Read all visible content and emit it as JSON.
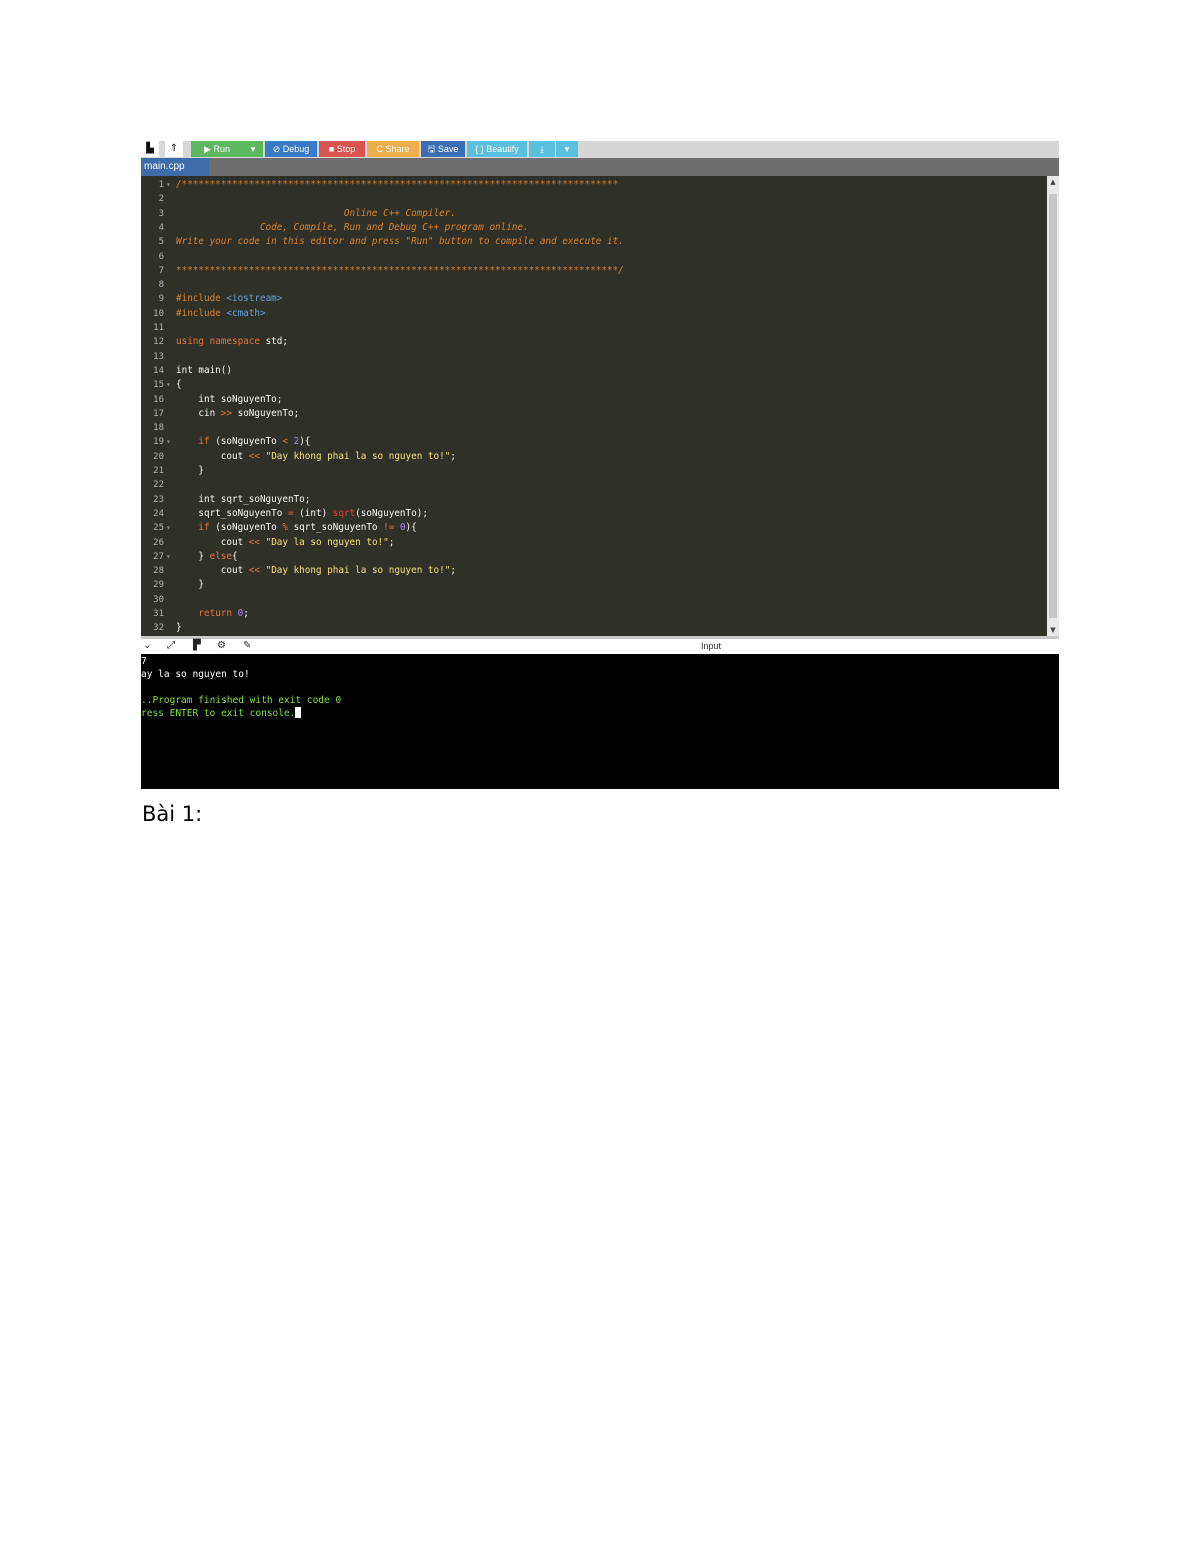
{
  "toolbar": {
    "new_file_icon": "file-icon",
    "upload_icon": "upload-icon",
    "run_label": "▶ Run",
    "run_dropdown": "▾",
    "debug_label": "⊘ Debug",
    "stop_label": "■ Stop",
    "share_label": "C Share",
    "save_label": "🖫 Save",
    "beautify_label": "{ } Beautify",
    "download_label": "⤓",
    "download_dropdown": "▾",
    "colors": {
      "run": "#5cb85c",
      "debug": "#3a7bc8",
      "stop": "#d9534f",
      "share": "#f0ad4e",
      "save": "#3a6fb5",
      "beautify": "#5bc0de",
      "download": "#5bc0de"
    }
  },
  "tabs": [
    {
      "label": "main.cpp"
    }
  ],
  "editor": {
    "line_numbers": [
      "1",
      "2",
      "3",
      "4",
      "5",
      "6",
      "7",
      "8",
      "9",
      "10",
      "11",
      "12",
      "13",
      "14",
      "15",
      "16",
      "17",
      "18",
      "19",
      "20",
      "21",
      "22",
      "23",
      "24",
      "25",
      "26",
      "27",
      "28",
      "29",
      "30",
      "31",
      "32"
    ],
    "lines": [
      "/******************************************************************************",
      "",
      "                              Online C++ Compiler.",
      "               Code, Compile, Run and Debug C++ program online.",
      "Write your code in this editor and press \"Run\" button to compile and execute it.",
      "",
      "*******************************************************************************/",
      "",
      "#include <iostream>",
      "#include <cmath>",
      "",
      "using namespace std;",
      "",
      "int main()",
      "{",
      "    int soNguyenTo;",
      "    cin >> soNguyenTo;",
      "",
      "    if (soNguyenTo < 2){",
      "        cout << \"Day khong phai la so nguyen to!\";",
      "    }",
      "",
      "    int sqrt_soNguyenTo;",
      "    sqrt_soNguyenTo = (int) sqrt(soNguyenTo);",
      "    if (soNguyenTo % sqrt_soNguyenTo != 0){",
      "        cout << \"Day la so nguyen to!\";",
      "    } else{",
      "        cout << \"Day khong phai la so nguyen to!\";",
      "    }",
      "",
      "    return 0;",
      "}"
    ]
  },
  "console_toolbar": {
    "input_label": "Input",
    "icons": [
      "chevron-down-icon",
      "expand-icon",
      "copy-icon",
      "gear-icon",
      "erase-icon"
    ]
  },
  "console": {
    "lines": [
      {
        "text": "7",
        "color": "#ffffff"
      },
      {
        "text": "ay la so nguyen to!",
        "color": "#ffffff"
      },
      {
        "text": "",
        "color": "#ffffff"
      },
      {
        "text": "..Program finished with exit code 0",
        "color": "#7ee23b"
      },
      {
        "text": "ress ENTER to exit console.",
        "color": "#7ee23b"
      }
    ]
  },
  "caption": "Bài 1:"
}
